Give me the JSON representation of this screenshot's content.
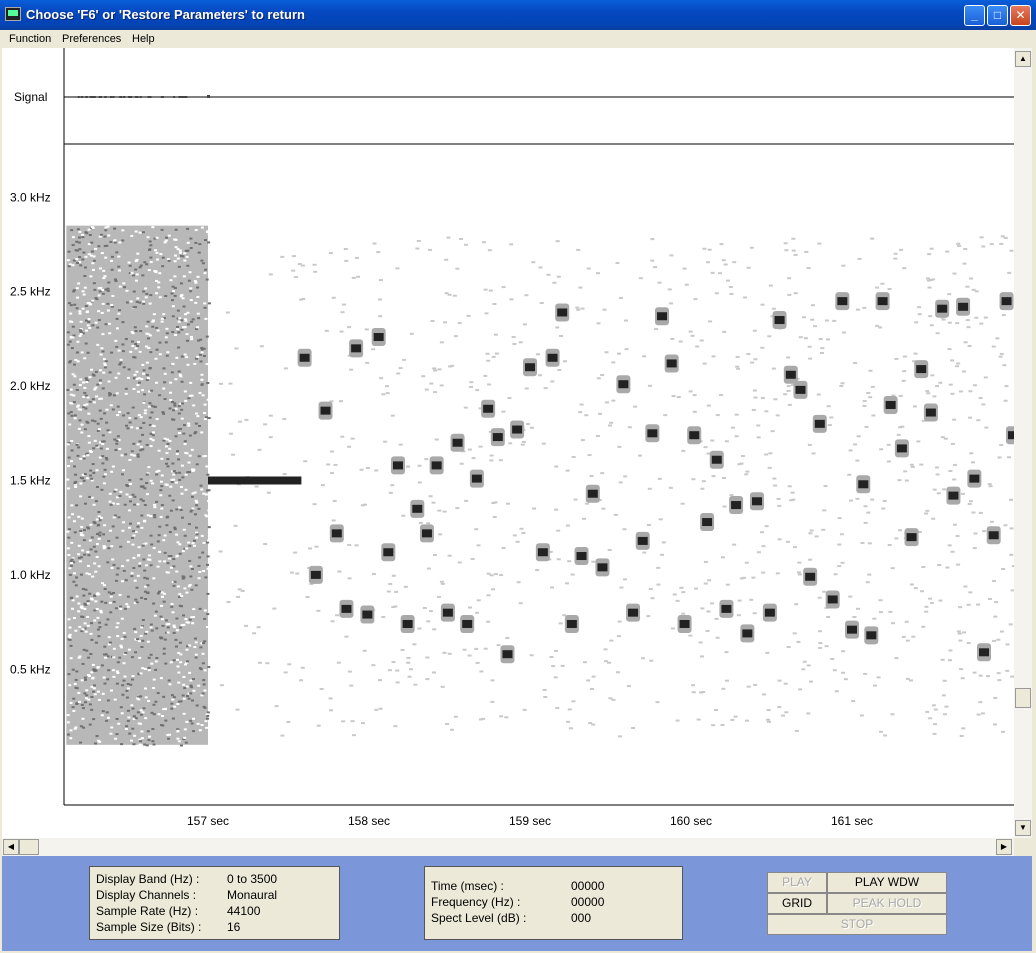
{
  "window": {
    "title": "Choose 'F6' or 'Restore Parameters' to return"
  },
  "menu": [
    "Function",
    "Preferences",
    "Help"
  ],
  "plot": {
    "signal_label": "Signal",
    "y_ticks": [
      {
        "value": 3.0,
        "label": "3.0 kHz"
      },
      {
        "value": 2.5,
        "label": "2.5 kHz"
      },
      {
        "value": 2.0,
        "label": "2.0 kHz"
      },
      {
        "value": 1.5,
        "label": "1.5 kHz"
      },
      {
        "value": 1.0,
        "label": "1.0 kHz"
      },
      {
        "value": 0.5,
        "label": "0.5 kHz"
      }
    ],
    "x_ticks": [
      {
        "value": 157,
        "label": "157 sec"
      },
      {
        "value": 158,
        "label": "158 sec"
      },
      {
        "value": 159,
        "label": "159 sec"
      },
      {
        "value": 160,
        "label": "160 sec"
      },
      {
        "value": 161,
        "label": "161 sec"
      }
    ]
  },
  "chart_data": {
    "type": "heatmap",
    "xlim": [
      156.12,
      162.0
    ],
    "ylim": [
      0,
      3.5
    ],
    "noise_burst": {
      "x": [
        156.12,
        157.0
      ],
      "y": [
        0.1,
        2.85
      ]
    },
    "tone": {
      "x": [
        157.0,
        157.58
      ],
      "y": 1.5
    },
    "syllables": [
      [
        157.6,
        2.15
      ],
      [
        157.67,
        1.0
      ],
      [
        157.73,
        1.87
      ],
      [
        157.8,
        1.22
      ],
      [
        157.86,
        0.82
      ],
      [
        157.92,
        2.2
      ],
      [
        157.99,
        0.79
      ],
      [
        158.06,
        2.26
      ],
      [
        158.12,
        1.12
      ],
      [
        158.18,
        1.58
      ],
      [
        158.24,
        0.74
      ],
      [
        158.3,
        1.35
      ],
      [
        158.36,
        1.22
      ],
      [
        158.42,
        1.58
      ],
      [
        158.49,
        0.8
      ],
      [
        158.55,
        1.7
      ],
      [
        158.61,
        0.74
      ],
      [
        158.67,
        1.51
      ],
      [
        158.74,
        1.88
      ],
      [
        158.8,
        1.73
      ],
      [
        158.86,
        0.58
      ],
      [
        158.92,
        1.77
      ],
      [
        159.0,
        2.1
      ],
      [
        159.08,
        1.12
      ],
      [
        159.14,
        2.15
      ],
      [
        159.2,
        2.39
      ],
      [
        159.26,
        0.74
      ],
      [
        159.32,
        1.1
      ],
      [
        159.39,
        1.43
      ],
      [
        159.45,
        1.04
      ],
      [
        159.58,
        2.01
      ],
      [
        159.64,
        0.8
      ],
      [
        159.7,
        1.18
      ],
      [
        159.76,
        1.75
      ],
      [
        159.82,
        2.37
      ],
      [
        159.88,
        2.12
      ],
      [
        159.96,
        0.74
      ],
      [
        160.02,
        1.74
      ],
      [
        160.1,
        1.28
      ],
      [
        160.16,
        1.61
      ],
      [
        160.22,
        0.82
      ],
      [
        160.28,
        1.37
      ],
      [
        160.35,
        0.69
      ],
      [
        160.41,
        1.39
      ],
      [
        160.49,
        0.8
      ],
      [
        160.55,
        2.35
      ],
      [
        160.62,
        2.06
      ],
      [
        160.68,
        1.98
      ],
      [
        160.74,
        0.99
      ],
      [
        160.8,
        1.8
      ],
      [
        160.88,
        0.87
      ],
      [
        160.94,
        2.45
      ],
      [
        161.0,
        0.71
      ],
      [
        161.07,
        1.48
      ],
      [
        161.12,
        0.68
      ],
      [
        161.19,
        2.45
      ],
      [
        161.24,
        1.9
      ],
      [
        161.31,
        1.67
      ],
      [
        161.37,
        1.2
      ],
      [
        161.43,
        2.09
      ],
      [
        161.49,
        1.86
      ],
      [
        161.56,
        2.41
      ],
      [
        161.63,
        1.42
      ],
      [
        161.69,
        2.42
      ],
      [
        161.76,
        1.51
      ],
      [
        161.82,
        0.59
      ],
      [
        161.88,
        1.21
      ],
      [
        161.96,
        2.45
      ],
      [
        162.0,
        1.74
      ]
    ]
  },
  "info": {
    "display_band_label": "Display Band (Hz) :",
    "display_band_value": "0 to 3500",
    "channels_label": "Display Channels :",
    "channels_value": "Monaural",
    "sample_rate_label": "Sample Rate (Hz) :",
    "sample_rate_value": "44100",
    "sample_size_label": "Sample Size (Bits) :",
    "sample_size_value": "16"
  },
  "readout": {
    "time_label": "Time (msec) :",
    "time_value": "00000",
    "freq_label": "Frequency (Hz) :",
    "freq_value": "00000",
    "level_label": "Spect Level (dB) :",
    "level_value": "000"
  },
  "buttons": {
    "play": "PLAY",
    "play_wdw": "PLAY WDW",
    "grid": "GRID",
    "peak_hold": "PEAK HOLD",
    "stop": "STOP"
  }
}
